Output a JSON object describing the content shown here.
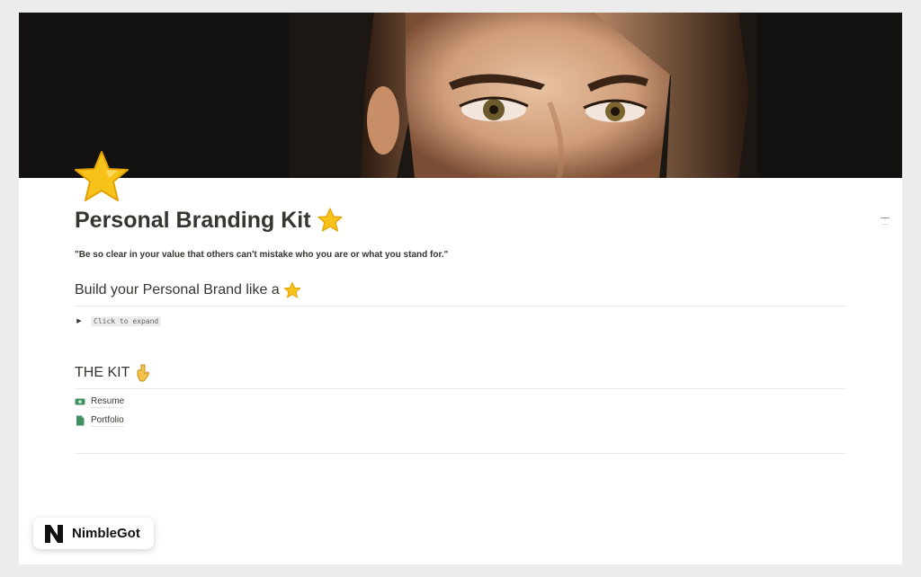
{
  "cover": {
    "description_icon": "portrait-cover-image"
  },
  "page": {
    "icon": "star-icon",
    "title": "Personal Branding Kit",
    "quote": "\"Be so clear in your value that others can't mistake who you are or what you stand for.\""
  },
  "section_brand": {
    "heading": "Build your Personal Brand like  a",
    "toggle_label": "Click to expand"
  },
  "section_kit": {
    "heading": "THE KIT",
    "items": [
      {
        "label": "Resume",
        "icon": "money-icon"
      },
      {
        "label": "Portfolio",
        "icon": "page-icon"
      }
    ]
  },
  "badge": {
    "brand": "NimbleGot",
    "logo": "n-logo-icon"
  },
  "colors": {
    "text": "#37352f",
    "star": "#f5b400",
    "cover_bg": "#141210"
  }
}
